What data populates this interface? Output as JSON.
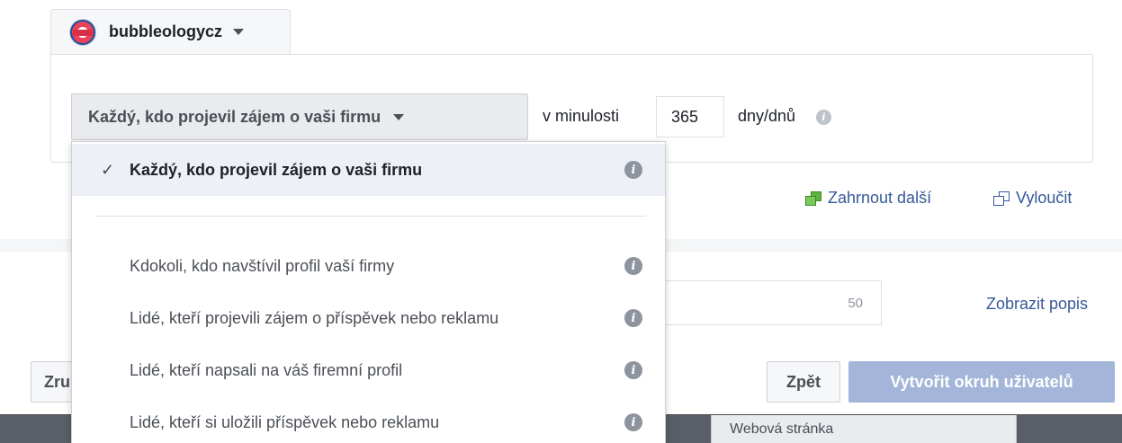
{
  "account": {
    "name": "bubbleologycz",
    "avatar_icon": "bubble-tea-logo-avatar"
  },
  "audience_rule": {
    "selected": "Každý, kdo projevil zájem o vaši firmu",
    "past_label": "v minulosti",
    "days_value": "365",
    "days_unit": "dny/dnů"
  },
  "actions": {
    "include": "Zahrnout další",
    "exclude": "Vyloučit"
  },
  "description": {
    "char_count": "50",
    "show_link": "Zobrazit popis"
  },
  "buttons": {
    "cancel": "Zru",
    "back": "Zpět",
    "create": "Vytvořit okruh uživatelů"
  },
  "table_strip": {
    "cell": "Webová stránka"
  },
  "dropdown": {
    "selected_item": "Každý, kdo projevil zájem o vaši firmu",
    "items": [
      "Kdokoli, kdo navštívil profil vaší firmy",
      "Lidé, kteří projevili zájem o příspěvek nebo reklamu",
      "Lidé, kteří napsali na váš firemní profil",
      "Lidé, kteří si uložili příspěvek nebo reklamu"
    ]
  },
  "colors": {
    "link": "#365899",
    "primary_disabled": "#a3b5d8",
    "selected_row": "#edf0f6"
  }
}
